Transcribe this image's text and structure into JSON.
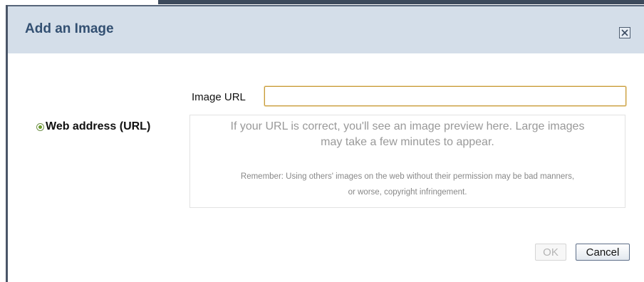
{
  "dialog": {
    "title": "Add an Image",
    "close_icon": "close-x-icon"
  },
  "source_options": {
    "selected": "Web address (URL)",
    "items": [
      {
        "label": "Web address (URL)",
        "checked": true
      }
    ]
  },
  "url_field": {
    "label": "Image URL",
    "value": "",
    "placeholder": ""
  },
  "preview": {
    "hint_line1": "If your URL is correct, you'll see an image preview here. Large images",
    "hint_line2": "may take a few minutes to appear.",
    "warning_line1": "Remember: Using others' images on the web without their permission may be bad manners,",
    "warning_line2": "or worse, copyright infringement."
  },
  "buttons": {
    "ok": {
      "label": "OK",
      "disabled": true
    },
    "cancel": {
      "label": "Cancel"
    }
  },
  "colors": {
    "titlebar": "#d4dee9",
    "title_text": "#335072",
    "radio_accent": "#6a9c28",
    "input_border": "#c79a3a"
  }
}
